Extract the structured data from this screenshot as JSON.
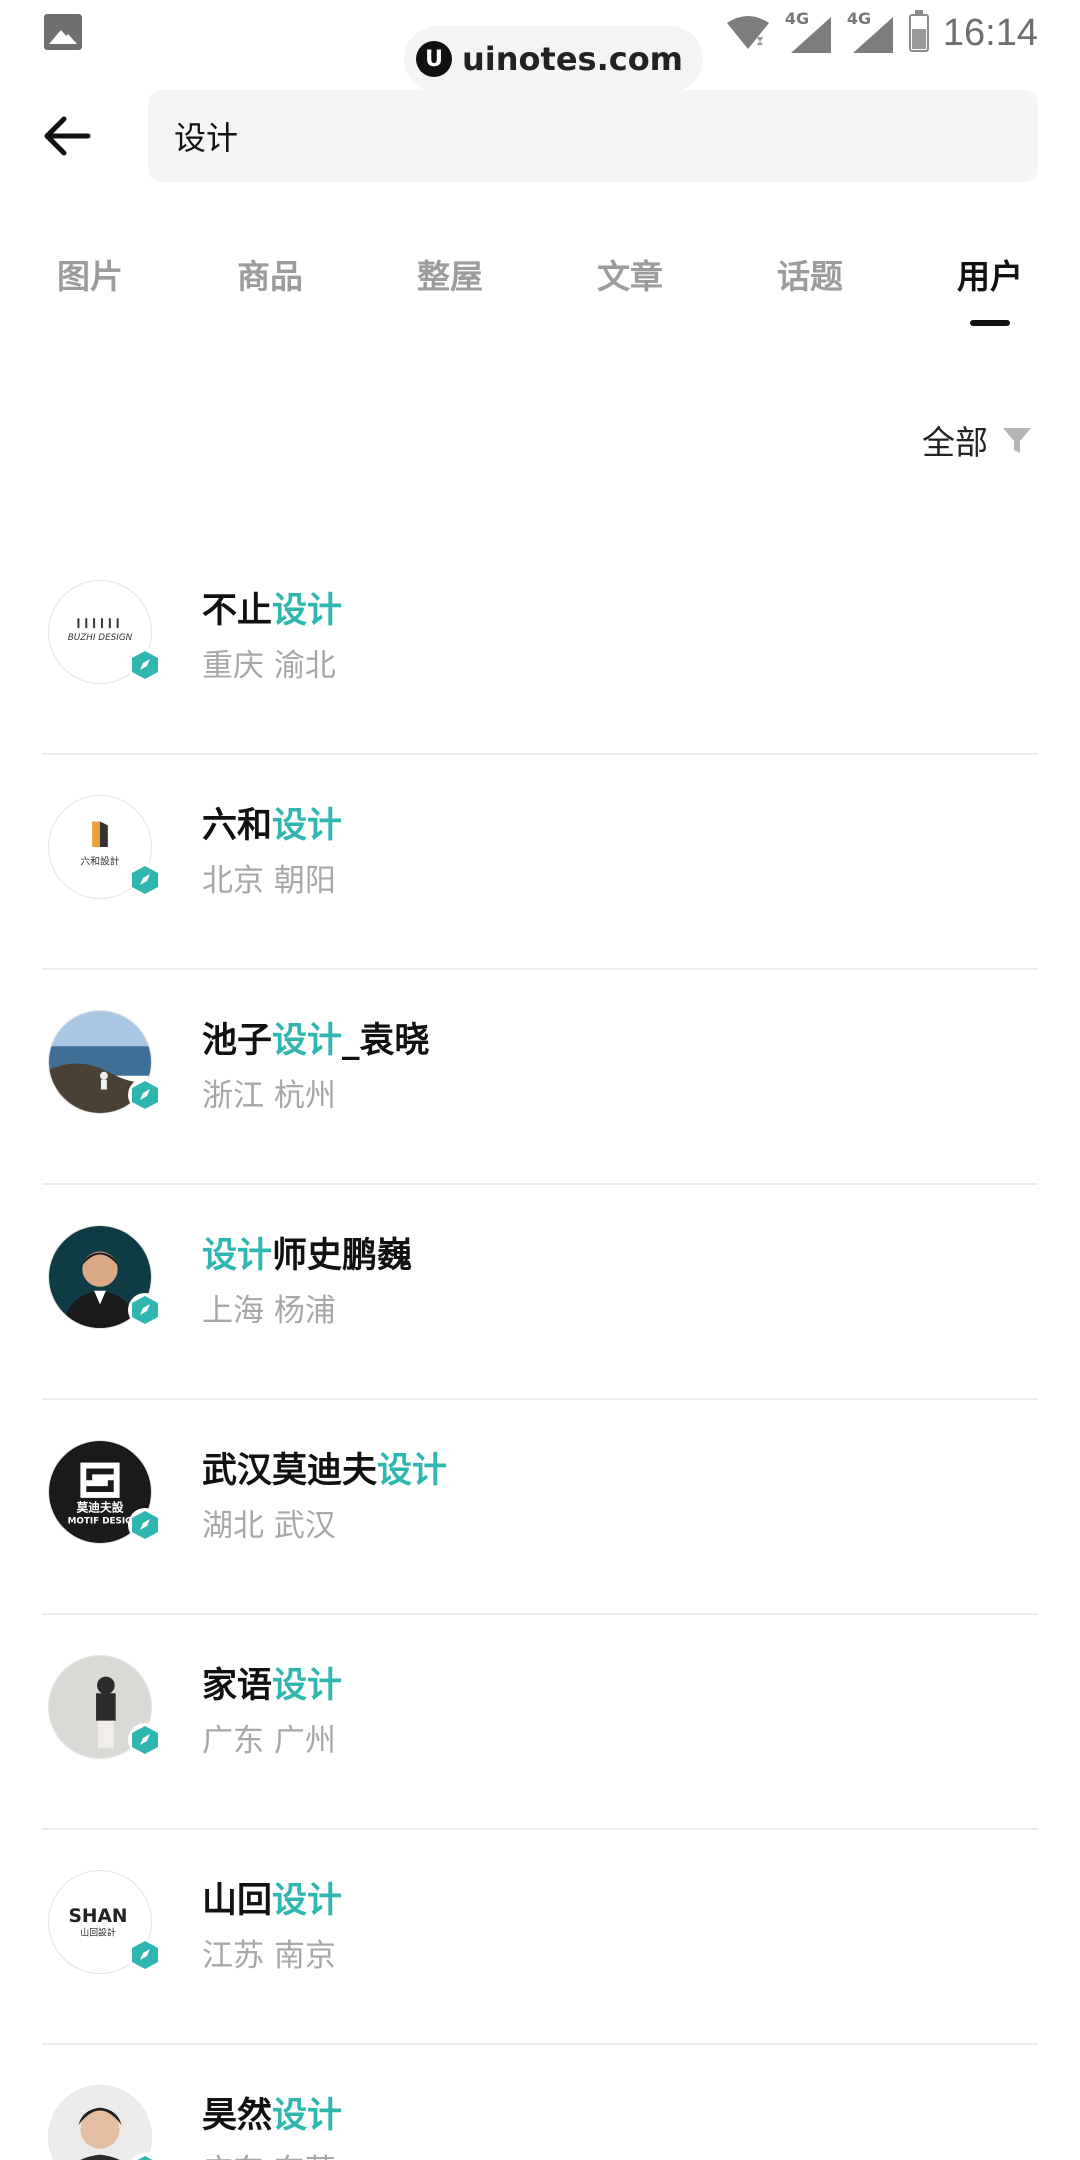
{
  "status_bar": {
    "network_1": "4G",
    "network_2": "4G",
    "time": "16:14",
    "icons": [
      "gallery-icon",
      "wifi-icon",
      "signal-icon",
      "battery-icon"
    ]
  },
  "watermark": {
    "logo": "U",
    "text": "uinotes.com"
  },
  "search": {
    "query": "设计"
  },
  "tabs": [
    {
      "label": "图片",
      "active": false
    },
    {
      "label": "商品",
      "active": false
    },
    {
      "label": "整屋",
      "active": false
    },
    {
      "label": "文章",
      "active": false
    },
    {
      "label": "话题",
      "active": false
    },
    {
      "label": "用户",
      "active": true
    }
  ],
  "filter": {
    "label": "全部",
    "icon": "filter-icon"
  },
  "colors": {
    "highlight": "#2fb6b0",
    "badge": "#2fb6b0",
    "text": "#111111",
    "subtext": "#a7a7a7"
  },
  "users": [
    {
      "name_parts": [
        "不止",
        "设计",
        ""
      ],
      "location": "重庆 渝北",
      "avatar": "logo-buzhi"
    },
    {
      "name_parts": [
        "六和",
        "设计",
        ""
      ],
      "location": "北京 朝阳",
      "avatar": "logo-liuhe"
    },
    {
      "name_parts": [
        "池子",
        "设计",
        "_袁晓"
      ],
      "location": "浙江 杭州",
      "avatar": "photo-coast"
    },
    {
      "name_parts": [
        "",
        "设计",
        "师史鹏巍"
      ],
      "location": "上海 杨浦",
      "avatar": "photo-person"
    },
    {
      "name_parts": [
        "武汉莫迪夫",
        "设计",
        ""
      ],
      "location": "湖北 武汉",
      "avatar": "logo-motif"
    },
    {
      "name_parts": [
        "家语",
        "设计",
        ""
      ],
      "location": "广东 广州",
      "avatar": "photo-wall"
    },
    {
      "name_parts": [
        "山回",
        "设计",
        ""
      ],
      "location": "江苏 南京",
      "avatar": "logo-shan"
    },
    {
      "name_parts": [
        "昊然",
        "设计",
        ""
      ],
      "location": "广东 东莞",
      "avatar": "photo-man"
    }
  ],
  "avatar_text": {
    "buzhi": "BUZHI DESIGN",
    "liuhe": "六和設計",
    "motif_cn": "莫迪夫設",
    "motif_en": "MOTIF DESIG",
    "shan_en": "SHAN",
    "shan_cn": "山回設計"
  }
}
